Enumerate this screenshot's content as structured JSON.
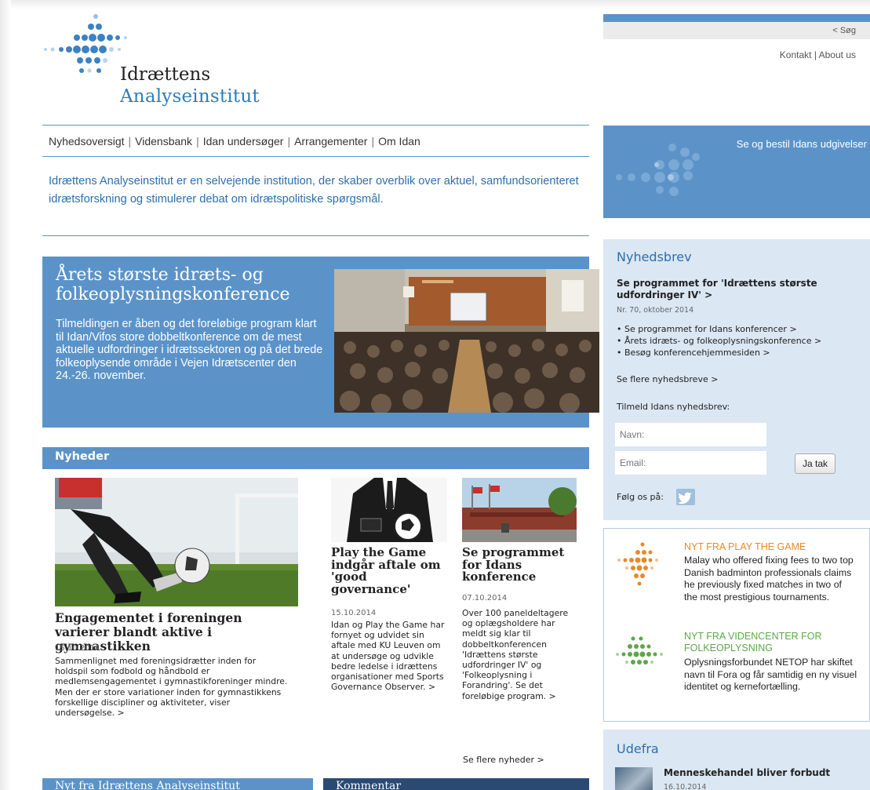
{
  "colors": {
    "brand_blue": "#5b93c9",
    "brand_text_blue": "#2c6fae",
    "panel_light": "#dbe7f3",
    "navy": "#2a4a73",
    "orange": "#e8892a",
    "green": "#5ba84a"
  },
  "logo": {
    "line1": "Idrættens",
    "line2": "Analyseinstitut"
  },
  "header": {
    "search_link": "< Søg",
    "links": [
      "Kontakt",
      "About us"
    ]
  },
  "nav": {
    "items": [
      "Nyhedsoversigt",
      "Vidensbank",
      "Idan undersøger",
      "Arrangementer",
      "Om Idan"
    ]
  },
  "intro": "Idrættens Analyseinstitut er en selvejende institution, der skaber overblik over aktuel, samfundsorienteret idrætsforskning og stimulerer debat om idrætspolitiske spørgsmål.",
  "hero": {
    "title": "Årets største idræts- og folkeoplysningskonference",
    "text": "Tilmeldingen er åben og det foreløbige program klart til Idan/Vifos store dobbeltkonference om de mest aktuelle udfordringer i idrætssektoren og på det brede folkeoplysende område i Vejen Idrætscenter den 24.-26. november."
  },
  "news": {
    "section_title": "Nyheder",
    "items": [
      {
        "title": "Engagementet i foreningen varierer blandt aktive i gymnastikken",
        "date": "15.10.2014",
        "text": "Sammenlignet med foreningsidrætter inden for holdspil som fodbold og håndbold er medlemsengagementet i gymnastikforeninger mindre. Men der er store variationer inden for gymnastikkens forskellige discipliner og aktiviteter, viser undersøgelse. >"
      },
      {
        "title": "Play the Game indgår aftale om 'good governance'",
        "date": "15.10.2014",
        "text": "Idan og Play the Game har fornyet og udvidet sin aftale med KU Leuven om at undersøge og udvikle bedre ledelse i idrættens organisationer med Sports Governance Observer. >"
      },
      {
        "title": "Se programmet for Idans konference",
        "date": "07.10.2014",
        "text": "Over 100 paneldeltagere og oplægsholdere har meldt sig klar til dobbeltkonferencen 'Idrættens største udfordringer IV' og 'Folkeoplysning i Forandring'. Se det foreløbige program. >"
      }
    ],
    "more_link": "Se flere nyheder >"
  },
  "bottom_bars": {
    "left": "Nyt fra Idrættens Analyseinstitut",
    "right": "Kommentar"
  },
  "promo": {
    "text": "Se og bestil Idans udgivelser"
  },
  "newsletter": {
    "title": "Nyhedsbrev",
    "headline": "Se programmet for 'Idrættens største udfordringer IV' >",
    "issue": "Nr. 70, oktober 2014",
    "bullets": [
      "Se programmet for Idans konferencer >",
      "Årets idræts- og folkeoplysningskonference >",
      "Besøg konferencehjemmesiden >"
    ],
    "more": "Se flere nyhedsbreve >",
    "signup_label": "Tilmeld Idans nyhedsbrev:",
    "name_placeholder": "Navn:",
    "email_placeholder": "Email:",
    "submit_label": "Ja tak",
    "follow_label": "Følg os på:"
  },
  "external": [
    {
      "title": "NYT FRA PLAY THE GAME",
      "text": "Malay who offered fixing fees to two top Danish badminton professionals claims he previously fixed matches in two of the most prestigious tournaments."
    },
    {
      "title": "NYT FRA VIDENCENTER FOR FOLKEOPLYSNING",
      "text": "Oplysningsforbundet NETOP har skiftet navn til Fora og får samtidig en ny visuel identitet og kernefortælling."
    }
  ],
  "udefra": {
    "title": "Udefra",
    "item_title": "Menneskehandel bliver forbudt",
    "item_date": "16.10.2014"
  }
}
